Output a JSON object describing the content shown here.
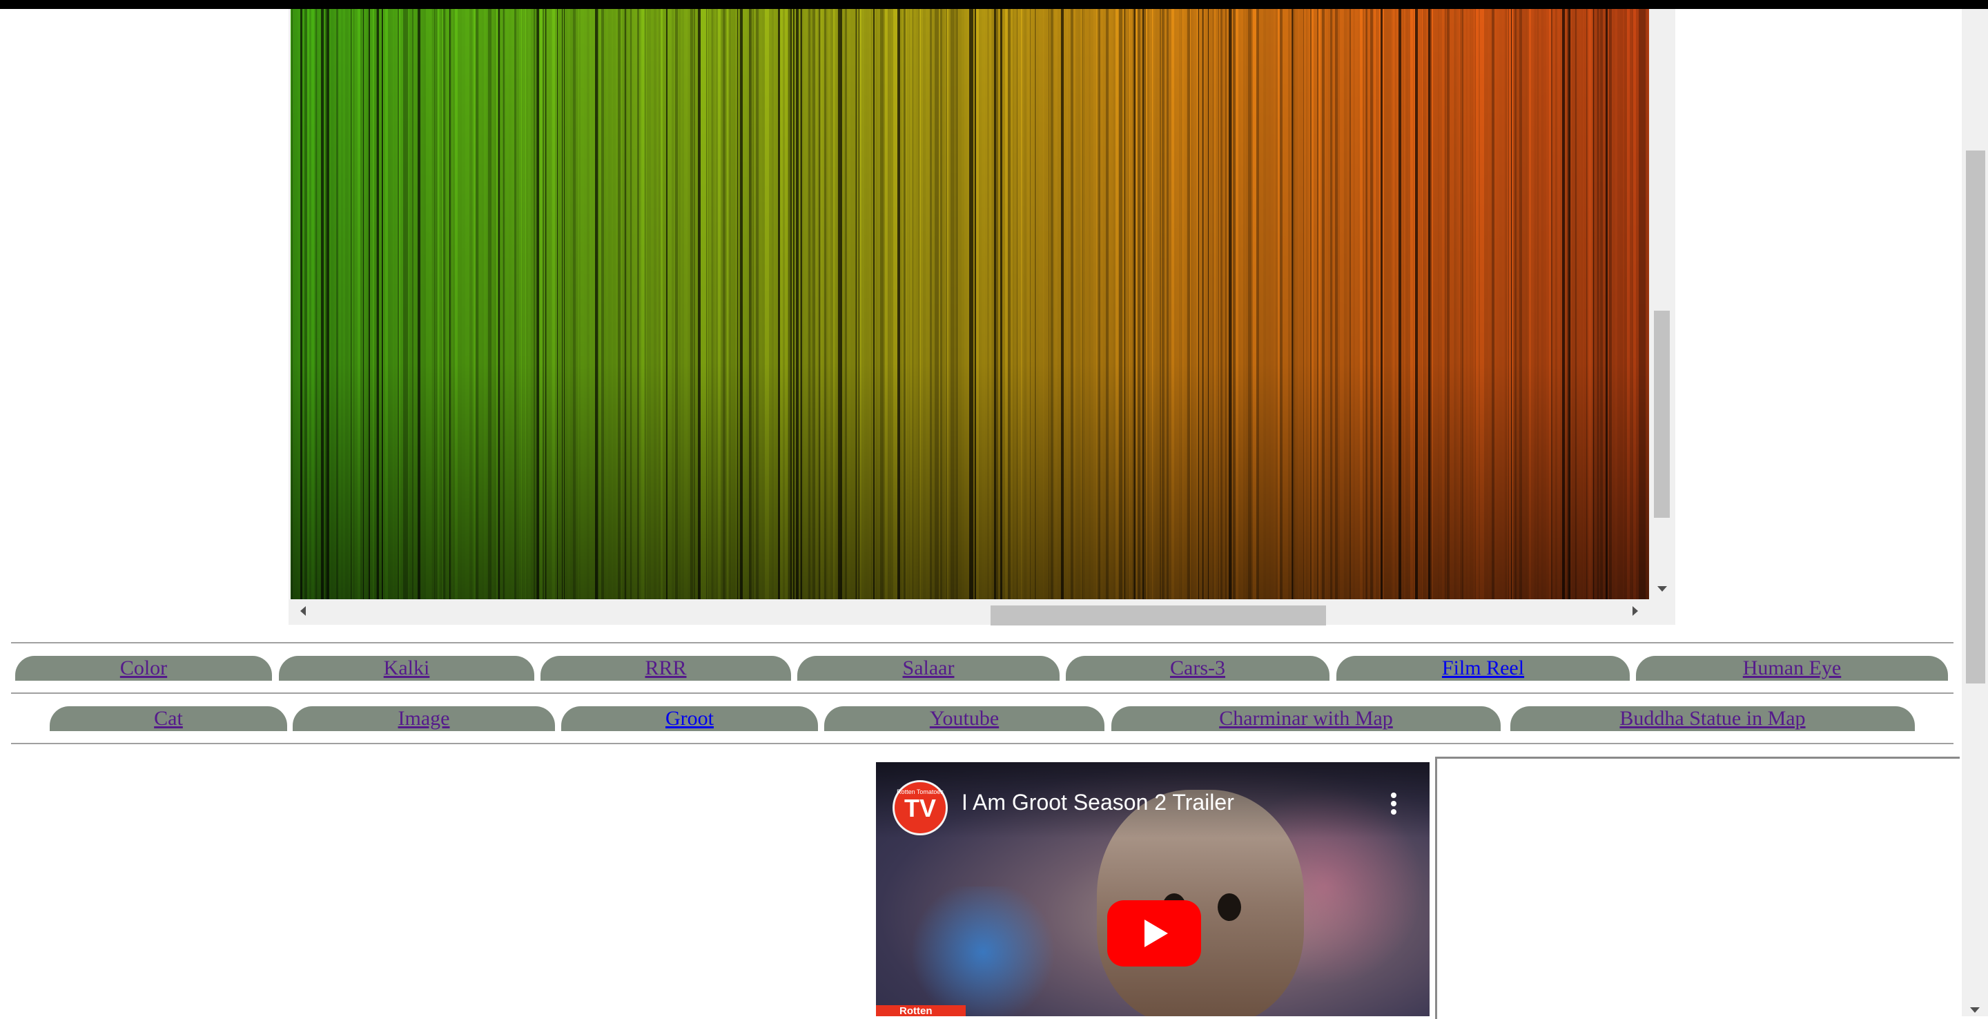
{
  "color_strip": {
    "gradient_stops": [
      "#3a9410",
      "#57a010",
      "#7f9a10",
      "#a78f10",
      "#c27410",
      "#c45410",
      "#a83a10"
    ]
  },
  "nav_row_1": [
    {
      "label": "Color",
      "visited": true
    },
    {
      "label": "Kalki",
      "visited": true
    },
    {
      "label": "RRR",
      "visited": true
    },
    {
      "label": "Salaar",
      "visited": true
    },
    {
      "label": "Cars-3",
      "visited": true
    },
    {
      "label": "Film Reel",
      "visited": false
    },
    {
      "label": "Human Eye",
      "visited": true
    }
  ],
  "nav_row_2": [
    {
      "label": "Cat",
      "visited": true
    },
    {
      "label": "Image",
      "visited": true
    },
    {
      "label": "Groot",
      "visited": false
    },
    {
      "label": "Youtube",
      "visited": true
    },
    {
      "label": "Charminar with Map",
      "visited": true
    },
    {
      "label": "Buddha Statue in Map",
      "visited": true
    }
  ],
  "video": {
    "title": "I Am Groot Season 2 Trailer",
    "channel_logo_small": "Rotten Tomatoes",
    "channel_logo_big": "TV",
    "badge": "Rotten"
  },
  "colors": {
    "tab_bg": "#7f8b7f",
    "link_visited": "#551a8b",
    "link_unvisited": "#0000ee",
    "play_red": "#ff0000"
  }
}
